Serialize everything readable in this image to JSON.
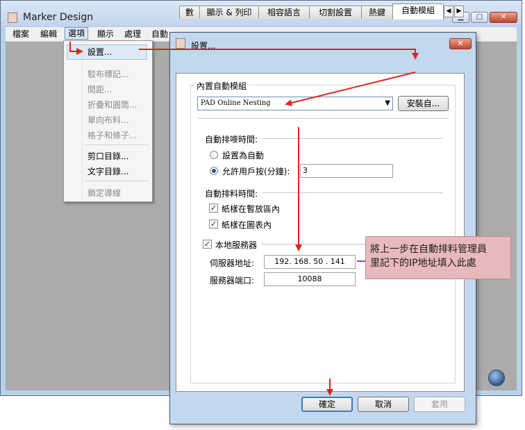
{
  "app": {
    "title": "Marker Design",
    "menu": [
      "檔案",
      "編輯",
      "選項",
      "顯示",
      "處理",
      "自動"
    ]
  },
  "options_menu": {
    "items": [
      {
        "label": "設置...",
        "enabled": true,
        "selected": true
      },
      {
        "label": "駁布標記...",
        "enabled": false
      },
      {
        "label": "間距...",
        "enabled": false
      },
      {
        "label": "折疊和圓筒...",
        "enabled": false
      },
      {
        "label": "單向布料...",
        "enabled": false
      },
      {
        "label": "格子和條子...",
        "enabled": false
      },
      {
        "label": "剪口目錄...",
        "enabled": true
      },
      {
        "label": "文字目錄...",
        "enabled": true
      },
      {
        "label": "鎖定導線",
        "enabled": false
      }
    ]
  },
  "dialog": {
    "title": "設置...",
    "close_glyph": "✕",
    "tabs": [
      "數",
      "顯示 & 列印",
      "相容語言",
      "切割設置",
      "熱鍵",
      "自動模組"
    ],
    "active_tab": "自動模組",
    "tab_scroll": {
      "left": "◀",
      "right": "▶"
    },
    "builtin_group": {
      "label": "內置自動模組",
      "selected_module": "PAD Online Nesting",
      "install_button": "安裝自..."
    },
    "nesting_time": {
      "label": "自動排嘜時間:",
      "option_auto": "設置為自動",
      "option_user": "允許用戶按(分鐘):",
      "user_minutes": "3",
      "selected": "user"
    },
    "fabric_time": {
      "label": "自動排料時間:",
      "check1": {
        "label": "紙樣在暫放區內",
        "checked": true
      },
      "check2": {
        "label": "紙樣在圖表內",
        "checked": true
      }
    },
    "local_server": {
      "label": "本地服務器",
      "checked": true,
      "server_address_label": "伺服器地址:",
      "server_address": "192. 168. 50 . 141",
      "server_port_label": "服務器端口:",
      "server_port": "10088"
    },
    "buttons": {
      "ok": "確定",
      "cancel": "取消",
      "apply": "套用"
    }
  },
  "annotation": {
    "line1": "將上一步在自動排料管理員",
    "line2": "里記下的IP地址填入此處",
    "color": "#e8b9ba"
  },
  "colors": {
    "arrow": "#e0231c",
    "callout_line": "#9c3ea8"
  }
}
